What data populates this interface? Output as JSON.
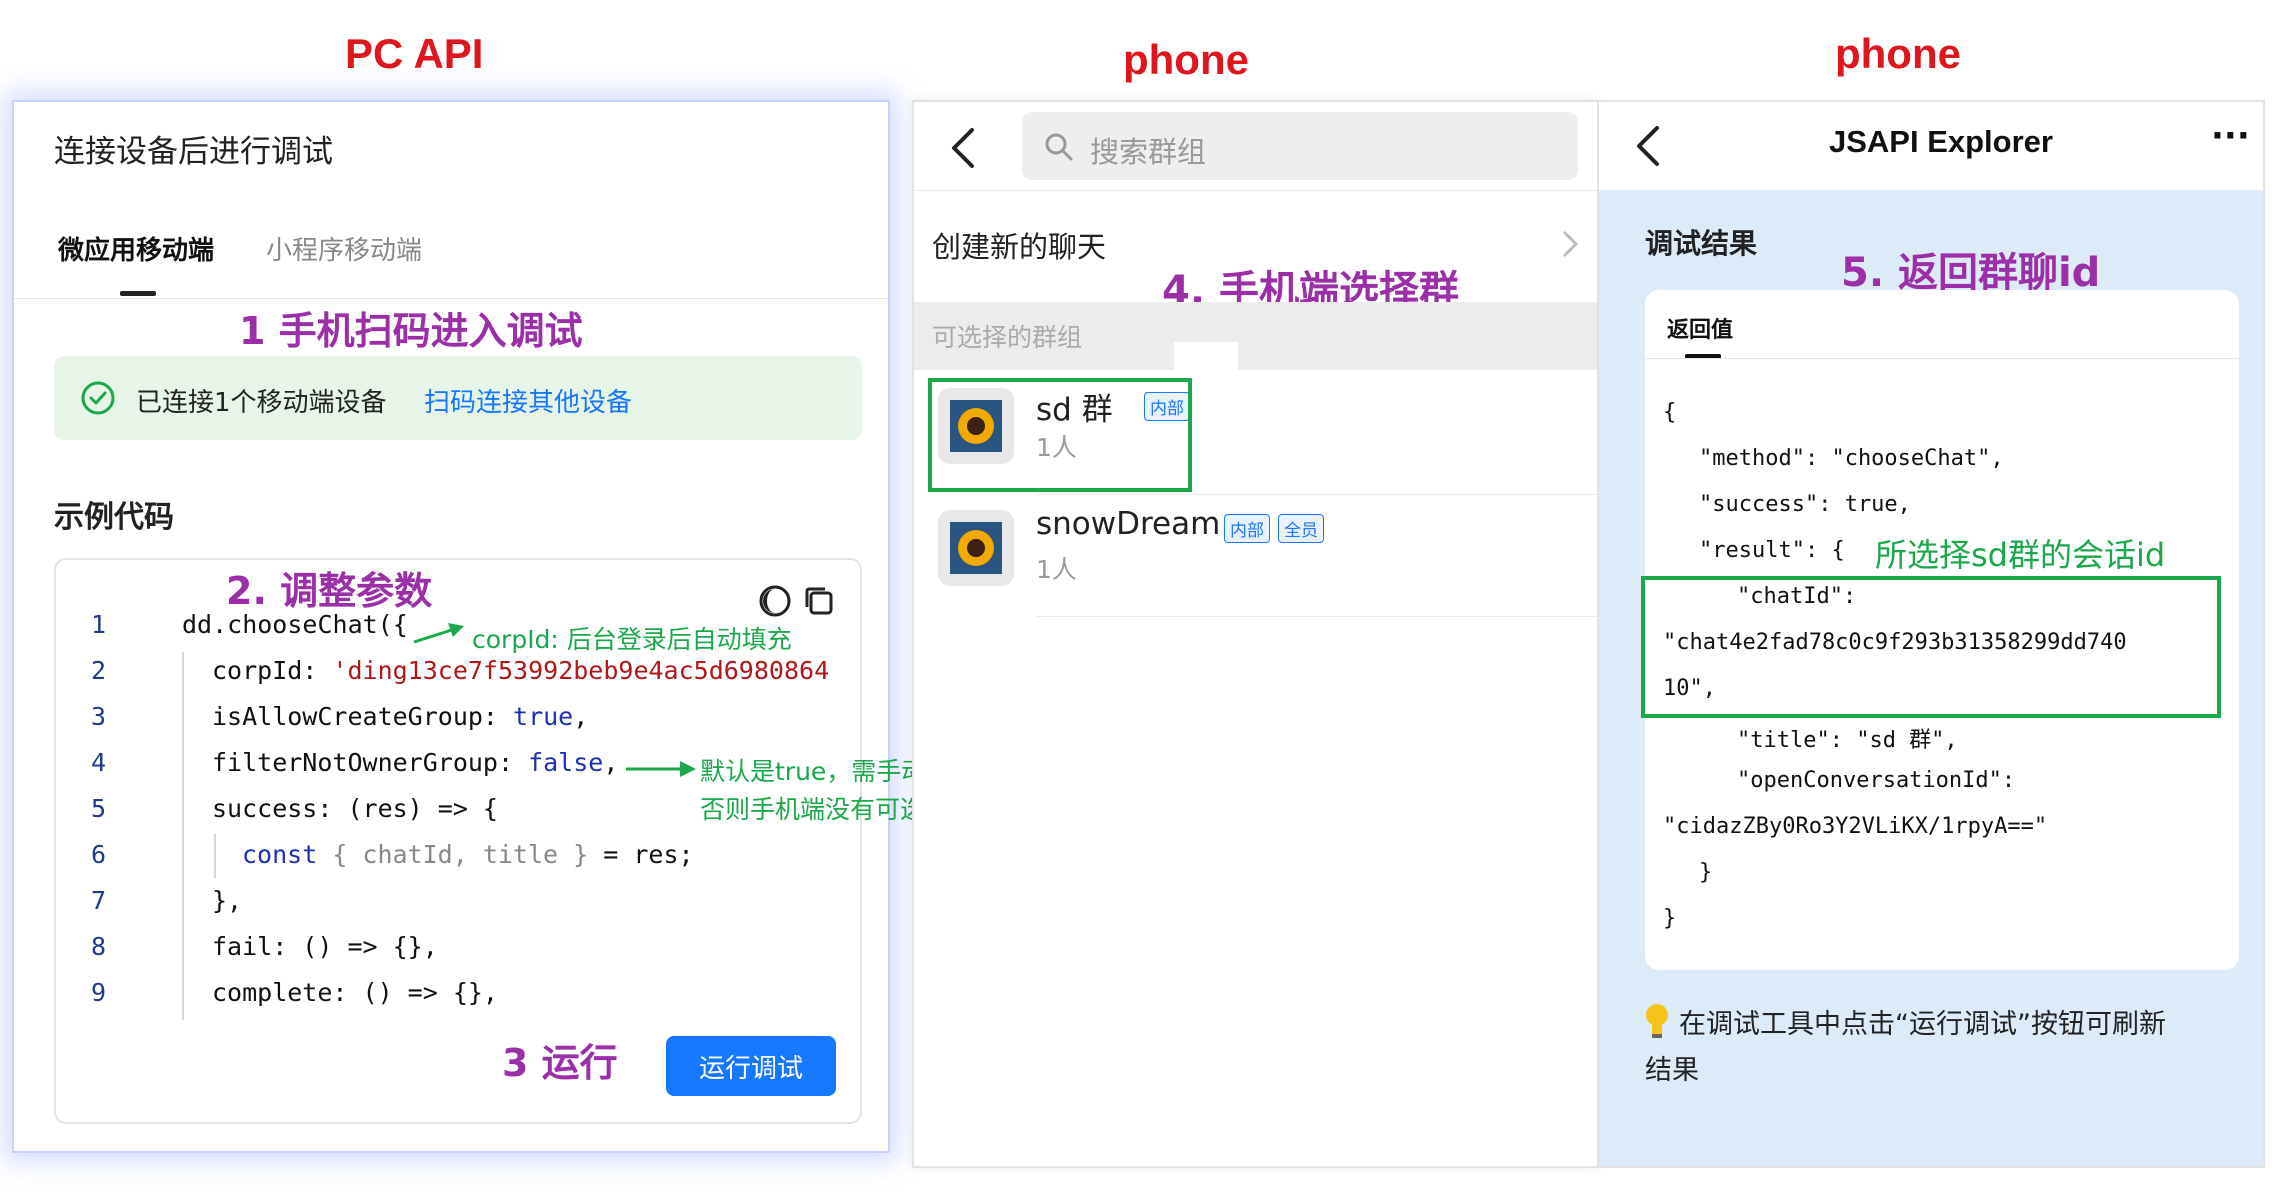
{
  "headers": {
    "pc_api": "PC API",
    "phone1": "phone",
    "phone2": "phone"
  },
  "panel1": {
    "title": "连接设备后进行调试",
    "tabs": [
      "微应用移动端",
      "小程序移动端"
    ],
    "step1": "1 手机扫码进入调试",
    "connected_text": "已连接1个移动端设备",
    "scan_link": "扫码连接其他设备",
    "example_title": "示例代码",
    "step2": "2. 调整参数",
    "code_lines": {
      "n": [
        "1",
        "2",
        "3",
        "4",
        "5",
        "6",
        "7",
        "8",
        "9"
      ],
      "l1": "dd.chooseChat({",
      "l2_key": "corpId: ",
      "l2_val": "'ding13ce7f53992beb9e4ac5d6980864",
      "l3_key": "isAllowCreateGroup: ",
      "l3_val": "true",
      "l3_end": ",",
      "l4_key": "filterNotOwnerGroup: ",
      "l4_val": "false",
      "l4_end": ",",
      "l5": "success: (res) => {",
      "l6_const": "const",
      "l6_open": " { ",
      "l6_vars": "chatId, title",
      "l6_close": " }",
      "l6_end": " = res;",
      "l7": "},",
      "l8": "fail: () => {},",
      "l9": "complete: () => {},"
    },
    "note_corpid": "corpId: 后台登录后自动填充",
    "note_filter_1": "默认是true，需手动改为false",
    "note_filter_2": "否则手机端没有可选群聊",
    "step3": "3 运行",
    "run_button": "运行调试"
  },
  "panel2": {
    "search_placeholder": "搜索群组",
    "create_chat": "创建新的聊天",
    "step4": "4. 手机端选择群",
    "section_label": "可选择的群组",
    "groups": [
      {
        "name": "sd 群",
        "tags": [
          "内部"
        ],
        "members": "1人"
      },
      {
        "name": "snowDream",
        "tags": [
          "内部",
          "全员"
        ],
        "members": "1人"
      }
    ]
  },
  "panel3": {
    "title": "JSAPI Explorer",
    "more": "···",
    "result_title": "调试结果",
    "step5": "5. 返回群聊id",
    "tab": "返回值",
    "json_lines": {
      "open": "{",
      "method": "\"method\": \"chooseChat\",",
      "success": "\"success\": true,",
      "result": "\"result\": {",
      "chatid_key": "\"chatId\":",
      "chatid_val1": "\"chat4e2fad78c0c9f293b31358299dd740",
      "chatid_val2": "10\",",
      "title": "\"title\": \"sd 群\",",
      "open_conv_key": "\"openConversationId\":",
      "open_conv_val": "\"cidazZBy0Ro3Y2VLiKX/1rpyA==\"",
      "close_inner": "}",
      "close": "}"
    },
    "annotation": "所选择sd群的会话id",
    "tip": "在调试工具中点击“运行调试”按钮可刷新",
    "tip2": "结果"
  },
  "colors": {
    "header_red": "#e0161e",
    "step_purple": "#9b2fa8",
    "highlight_green": "#1ba84a",
    "primary_blue": "#1677ff"
  }
}
